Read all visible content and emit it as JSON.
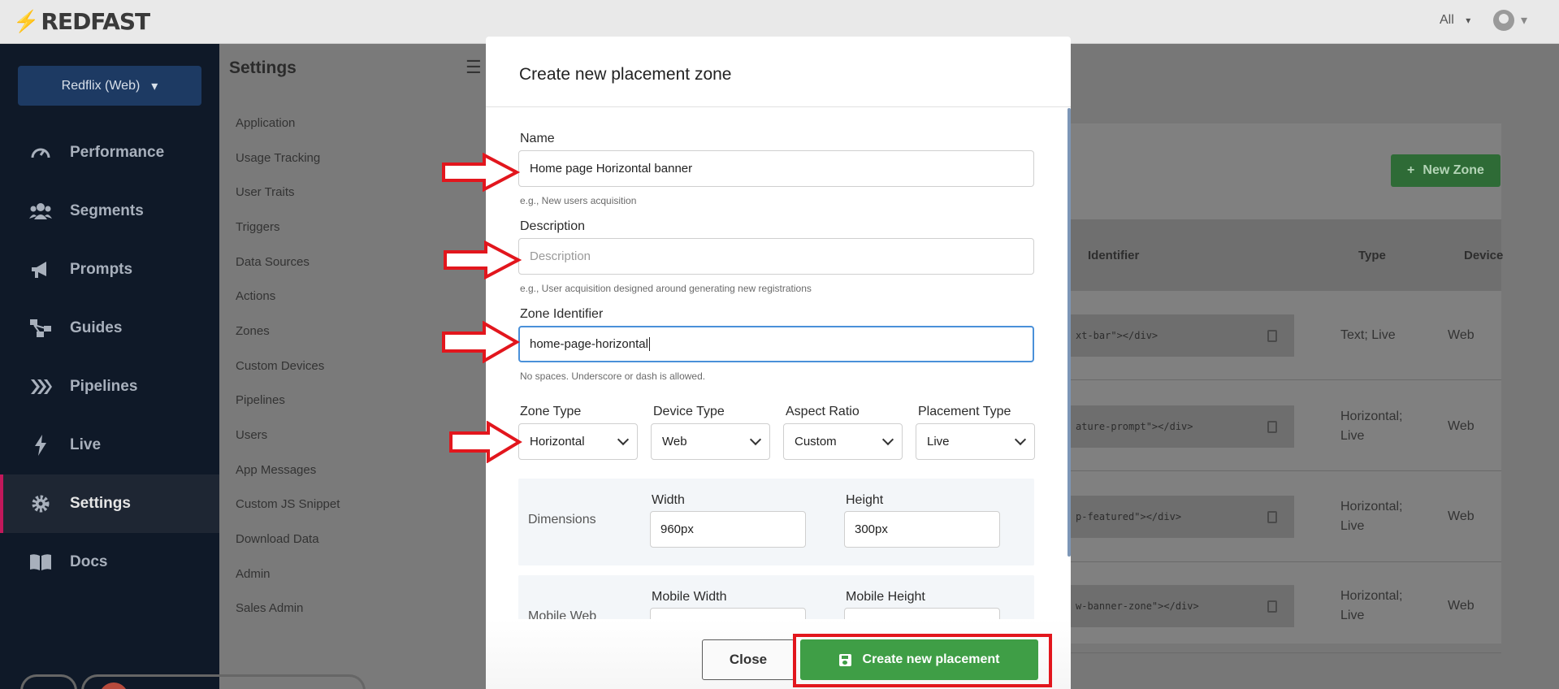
{
  "topbar": {
    "logo_text": "REDFAST",
    "filter_label": "All",
    "caret": "▾"
  },
  "sidebar": {
    "app_selector": "Redflix (Web)",
    "app_selector_caret": "▾",
    "items": [
      {
        "label": "Performance",
        "icon": "gauge-icon"
      },
      {
        "label": "Segments",
        "icon": "users-icon"
      },
      {
        "label": "Prompts",
        "icon": "megaphone-icon"
      },
      {
        "label": "Guides",
        "icon": "sitemap-icon"
      },
      {
        "label": "Pipelines",
        "icon": "chevrons-icon"
      },
      {
        "label": "Live",
        "icon": "bolt-icon"
      },
      {
        "label": "Settings",
        "icon": "gear-icon",
        "active": true
      },
      {
        "label": "Docs",
        "icon": "book-icon"
      }
    ]
  },
  "settings": {
    "title": "Settings",
    "links": [
      "Application",
      "Usage Tracking",
      "User Traits",
      "Triggers",
      "Data Sources",
      "Actions",
      "Zones",
      "Custom Devices",
      "Pipelines",
      "Users",
      "App Messages",
      "Custom JS Snippet",
      "Download Data",
      "Admin",
      "Sales Admin"
    ]
  },
  "zones_table": {
    "new_zone_label": "New Zone",
    "headers": {
      "identifier": "Identifier",
      "type": "Type",
      "device": "Device"
    },
    "rows": [
      {
        "code": "xt-bar\"></div>",
        "type_line1": "Text; Live",
        "type_line2": "",
        "device": "Web"
      },
      {
        "code": "ature-prompt\"></div>",
        "type_line1": "Horizontal;",
        "type_line2": "Live",
        "device": "Web"
      },
      {
        "code": "p-featured\"></div>",
        "type_line1": "Horizontal;",
        "type_line2": "Live",
        "device": "Web"
      },
      {
        "code": "w-banner-zone\"></div>",
        "type_line1": "Horizontal;",
        "type_line2": "Live",
        "device": "Web"
      }
    ]
  },
  "modal": {
    "title": "Create new placement zone",
    "name": {
      "label": "Name",
      "value": "Home page Horizontal banner",
      "hint": "e.g., New users acquisition"
    },
    "description": {
      "label": "Description",
      "placeholder": "Description",
      "hint": "e.g., User acquisition designed around generating new registrations"
    },
    "zone_identifier": {
      "label": "Zone Identifier",
      "value": "home-page-horizontal",
      "hint": "No spaces. Underscore or dash is allowed."
    },
    "zone_type": {
      "label": "Zone Type",
      "value": "Horizontal"
    },
    "device_type": {
      "label": "Device Type",
      "value": "Web"
    },
    "aspect_ratio": {
      "label": "Aspect Ratio",
      "value": "Custom"
    },
    "placement_type": {
      "label": "Placement Type",
      "value": "Live"
    },
    "dimensions": {
      "label": "Dimensions",
      "width_label": "Width",
      "width_value": "960px",
      "height_label": "Height",
      "height_value": "300px"
    },
    "mobile_web": {
      "label": "Mobile Web",
      "width_label": "Mobile Width",
      "height_label": "Mobile Height"
    },
    "close_label": "Close",
    "create_label": "Create new placement"
  },
  "colors": {
    "create_button": "#3f9e46",
    "annotation_red": "#e2161d",
    "focus_border": "#4a90d9"
  }
}
